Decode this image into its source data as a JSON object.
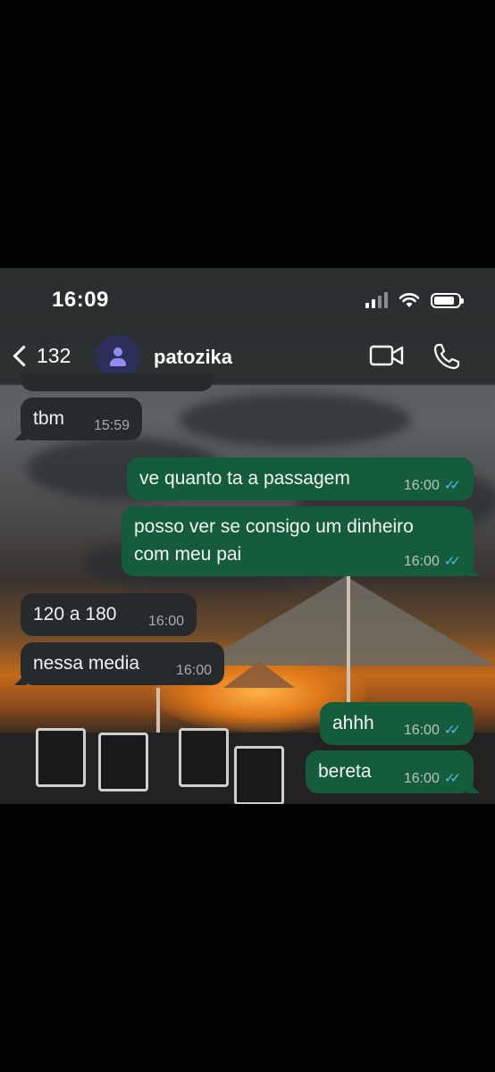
{
  "status_bar": {
    "time": "16:09",
    "signal_icon": "cellular-signal-icon",
    "wifi_icon": "wifi-icon",
    "battery_icon": "battery-icon"
  },
  "header": {
    "back_count": "132",
    "contact_name": "patozika",
    "video_icon": "video-camera-icon",
    "call_icon": "phone-icon"
  },
  "colors": {
    "incoming_bubble": "#262a2c",
    "outgoing_bubble": "#155c3d",
    "read_ticks": "#53bdeb",
    "avatar_bg": "#2c2f5a",
    "avatar_fg": "#8f8cf5"
  },
  "messages": [
    {
      "direction": "in",
      "text": "tbm",
      "time": "15:59"
    },
    {
      "direction": "out",
      "text": "ve quanto ta a passagem",
      "time": "16:00",
      "status": "read"
    },
    {
      "direction": "out",
      "text_line1": "posso ver se consigo um dinheiro",
      "text_line2": "com meu pai",
      "time": "16:00",
      "status": "read"
    },
    {
      "direction": "in",
      "text": "120 a 180",
      "time": "16:00"
    },
    {
      "direction": "in",
      "text": "nessa media",
      "time": "16:00"
    },
    {
      "direction": "out",
      "text": "ahhh",
      "time": "16:00",
      "status": "read"
    },
    {
      "direction": "out",
      "text": "bereta",
      "time": "16:00",
      "status": "read"
    }
  ]
}
